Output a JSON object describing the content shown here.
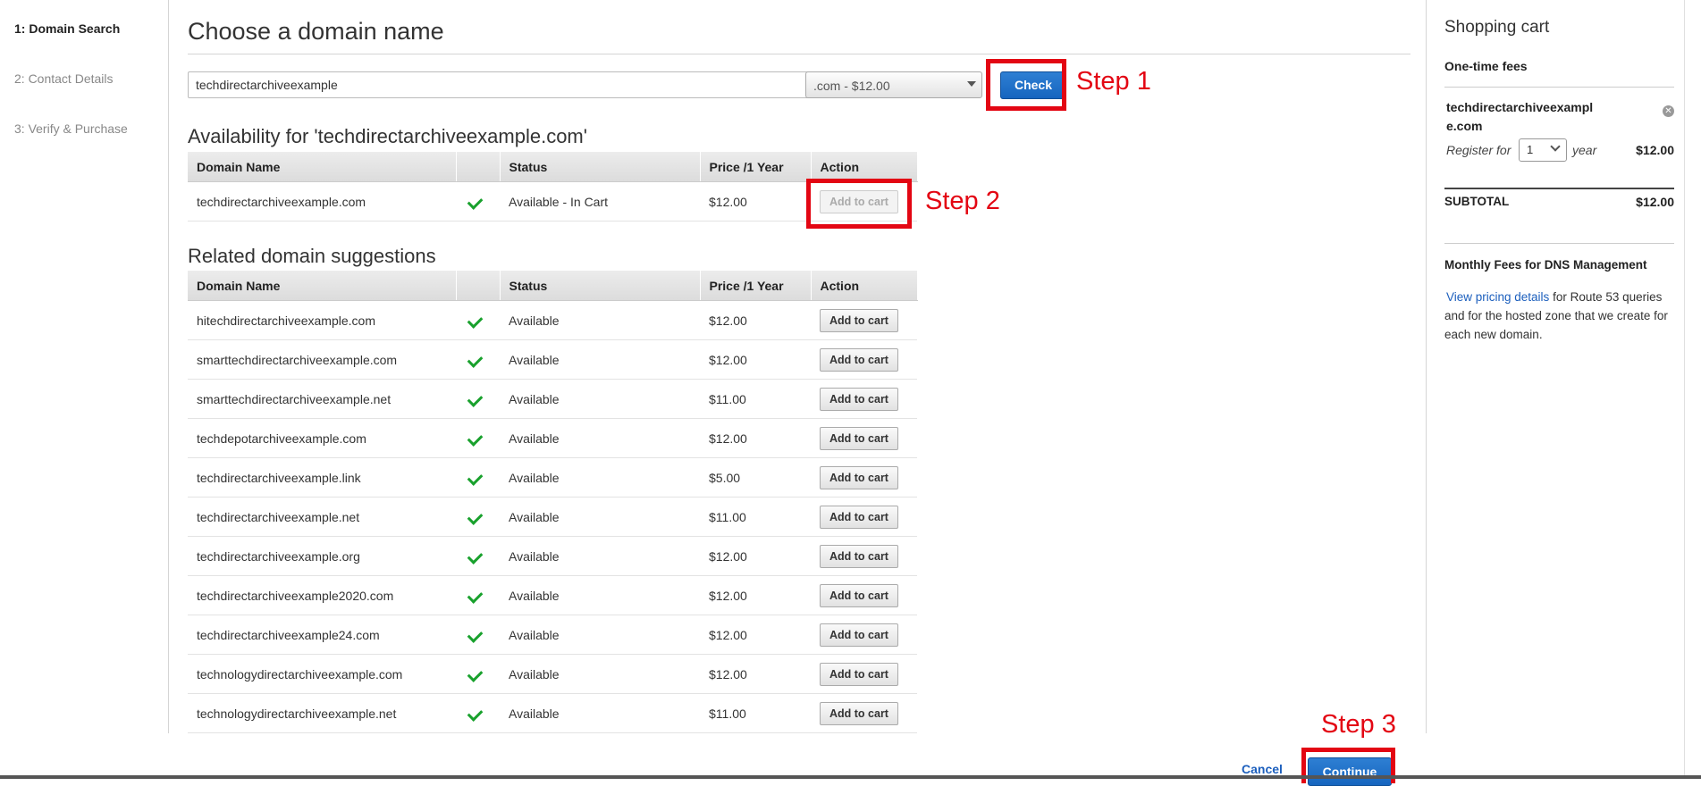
{
  "wizard": {
    "steps": [
      {
        "label": "1: Domain Search"
      },
      {
        "label": "2: Contact Details"
      },
      {
        "label": "3: Verify & Purchase"
      }
    ]
  },
  "main": {
    "title": "Choose a domain name",
    "search": {
      "value": "techdirectarchiveexample"
    },
    "tld": {
      "selected": ".com - $12.00"
    },
    "check_label": "Check"
  },
  "annotations": {
    "step1": "Step 1",
    "step2": "Step 2",
    "step3": "Step 3"
  },
  "availability": {
    "title": "Availability for 'techdirectarchiveexample.com'",
    "headers": {
      "domain": "Domain Name",
      "status": "Status",
      "price": "Price /1 Year",
      "action": "Action"
    },
    "row": {
      "domain": "techdirectarchiveexample.com",
      "status": "Available - In Cart",
      "price": "$12.00",
      "action": "Add to cart"
    }
  },
  "suggestions": {
    "title": "Related domain suggestions",
    "headers": {
      "domain": "Domain Name",
      "status": "Status",
      "price": "Price /1 Year",
      "action": "Action"
    },
    "rows": [
      {
        "domain": "hitechdirectarchiveexample.com",
        "status": "Available",
        "price": "$12.00",
        "action": "Add to cart"
      },
      {
        "domain": "smarttechdirectarchiveexample.com",
        "status": "Available",
        "price": "$12.00",
        "action": "Add to cart"
      },
      {
        "domain": "smarttechdirectarchiveexample.net",
        "status": "Available",
        "price": "$11.00",
        "action": "Add to cart"
      },
      {
        "domain": "techdepotarchiveexample.com",
        "status": "Available",
        "price": "$12.00",
        "action": "Add to cart"
      },
      {
        "domain": "techdirectarchiveexample.link",
        "status": "Available",
        "price": "$5.00",
        "action": "Add to cart"
      },
      {
        "domain": "techdirectarchiveexample.net",
        "status": "Available",
        "price": "$11.00",
        "action": "Add to cart"
      },
      {
        "domain": "techdirectarchiveexample.org",
        "status": "Available",
        "price": "$12.00",
        "action": "Add to cart"
      },
      {
        "domain": "techdirectarchiveexample2020.com",
        "status": "Available",
        "price": "$12.00",
        "action": "Add to cart"
      },
      {
        "domain": "techdirectarchiveexample24.com",
        "status": "Available",
        "price": "$12.00",
        "action": "Add to cart"
      },
      {
        "domain": "technologydirectarchiveexample.com",
        "status": "Available",
        "price": "$12.00",
        "action": "Add to cart"
      },
      {
        "domain": "technologydirectarchiveexample.net",
        "status": "Available",
        "price": "$11.00",
        "action": "Add to cart"
      }
    ]
  },
  "cart": {
    "title": "Shopping cart",
    "one_time_fees": "One-time fees",
    "item": {
      "domain_line1": "techdirectarchiveexampl",
      "domain_line2": "e.com",
      "register_for": "Register for",
      "years": "1",
      "year_label": "year",
      "price": "$12.00"
    },
    "subtotal_label": "SUBTOTAL",
    "subtotal_value": "$12.00",
    "monthly_title": "Monthly Fees for DNS Management",
    "pricing_link": "View pricing details",
    "monthly_text_1": " for Route 53 queries",
    "monthly_text_2": "and for the hosted zone that we create for",
    "monthly_text_3": "each new domain."
  },
  "footer": {
    "cancel": "Cancel",
    "continue": "Continue"
  },
  "icons": {
    "available": "check-icon",
    "remove": "remove-icon",
    "dropdown": "chevron-down-icon"
  },
  "colors": {
    "primary": "#1665bf",
    "available": "#19a12d",
    "annotation": "#e30613"
  }
}
